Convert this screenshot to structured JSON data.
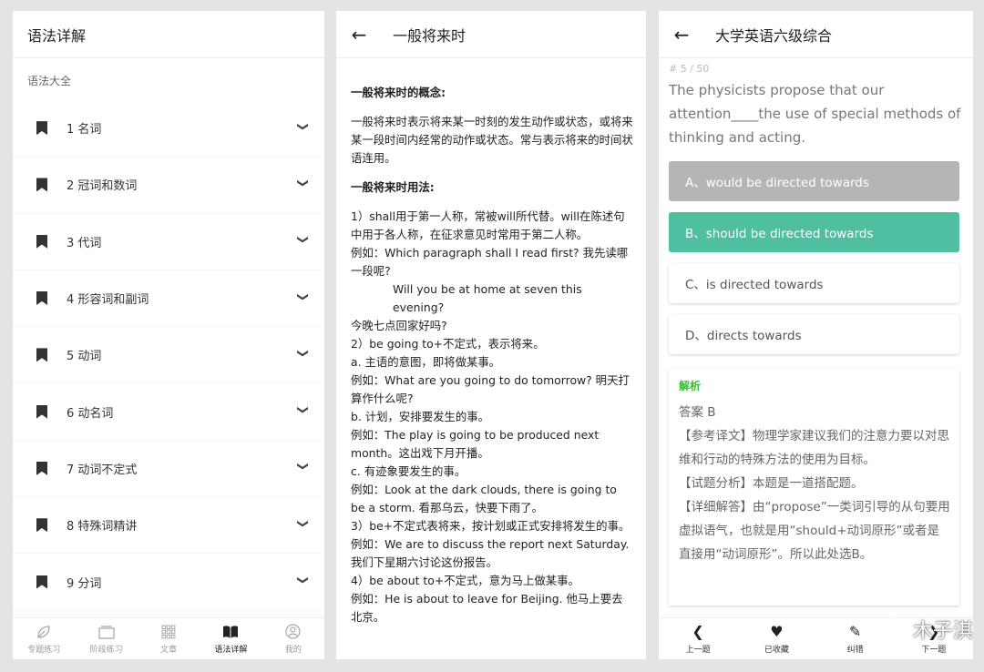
{
  "panel1": {
    "title": "语法详解",
    "section_label": "语法大全",
    "items": [
      {
        "label": "1 名词"
      },
      {
        "label": "2 冠词和数词"
      },
      {
        "label": "3 代词"
      },
      {
        "label": "4 形容词和副词"
      },
      {
        "label": "5 动词"
      },
      {
        "label": "6 动名词"
      },
      {
        "label": "7 动词不定式"
      },
      {
        "label": "8 特殊词精讲"
      },
      {
        "label": "9 分词"
      }
    ],
    "tabs": [
      {
        "label": "专题练习",
        "icon": "leaf-icon",
        "active": false
      },
      {
        "label": "阶段练习",
        "icon": "stack-icon",
        "active": false
      },
      {
        "label": "文章",
        "icon": "grid-icon",
        "active": false
      },
      {
        "label": "语法详解",
        "icon": "book-icon",
        "active": true
      },
      {
        "label": "我的",
        "icon": "user-icon",
        "active": false
      }
    ]
  },
  "panel2": {
    "title": "一般将来时",
    "heading1": "一般将来时的概念:",
    "concept": "一般将来时表示将来某一时刻的发生动作或状态，或将来某一段时间内经常的动作或状态。常与表示将来的时间状语连用。",
    "heading2": "一般将来时用法:",
    "lines": [
      "1）shall用于第一人称，常被will所代替。will在陈述句中用于各人称，在征求意见时常用于第二人称。",
      "例如：Which paragraph shall I read first? 我先读哪一段呢?",
      "Will you be at home at seven this evening?",
      "今晚七点回家好吗?",
      "2）be going to+不定式，表示将来。",
      "a. 主语的意图，即将做某事。",
      "例如：What are you going to do tomorrow? 明天打算作什么呢?",
      "b. 计划，安排要发生的事。",
      "例如：The play is going to be produced next month。这出戏下月开播。",
      "c. 有迹象要发生的事。",
      "例如：Look at the dark clouds, there is going to be a storm. 看那乌云，快要下雨了。",
      "3）be+不定式表将来，按计划或正式安排将发生的事。",
      "例如：We are to discuss the report next Saturday. 我们下星期六讨论这份报告。",
      "4）be about to+不定式，意为马上做某事。",
      "例如：He is about to leave for Beijing. 他马上要去北京。"
    ]
  },
  "panel3": {
    "title": "大学英语六级综合",
    "question_number": "# 5 / 50",
    "question": "The physicists propose that our attention____the use of special methods of thinking and acting.",
    "options": [
      {
        "label": "A、would be directed towards",
        "state": "wrong"
      },
      {
        "label": "B、should be directed towards",
        "state": "correct"
      },
      {
        "label": "C、is directed towards",
        "state": "normal"
      },
      {
        "label": "D、directs towards",
        "state": "normal"
      }
    ],
    "analysis_title": "解析",
    "answer": "答案 B",
    "translation": "【参考译文】物理学家建议我们的注意力要以对思维和行动的特殊方法的使用为目标。",
    "test_analysis": "【试题分析】本题是一道搭配题。",
    "detail": "【详细解答】由“propose”一类词引导的从句要用虚拟语气，也就是用“should+动词原形”或者是直接用“动词原形”。所以此处选B。",
    "bottom": [
      {
        "label": "上一题",
        "icon": "chevron-left-icon"
      },
      {
        "label": "已收藏",
        "icon": "heart-icon"
      },
      {
        "label": "纠错",
        "icon": "edit-icon"
      },
      {
        "label": "下一题",
        "icon": "chevron-right-icon"
      }
    ],
    "watermark": "木子淇"
  },
  "colors": {
    "correct": "#4fbea1",
    "wrong": "#b5b5b5",
    "analysis_title": "#3ab83a"
  }
}
